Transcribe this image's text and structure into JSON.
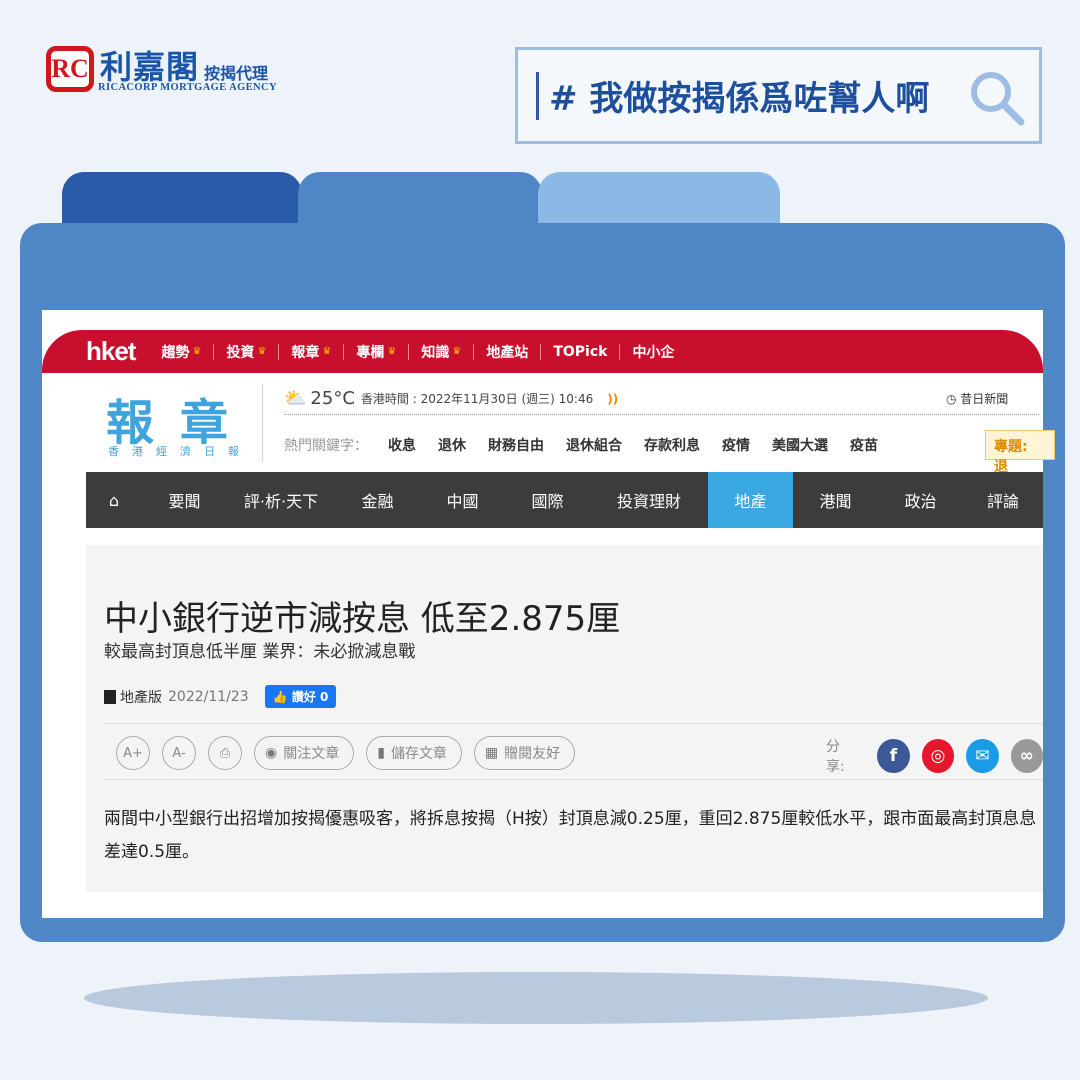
{
  "brand": {
    "logo_mark": "RC",
    "name_cn": "利嘉閣",
    "name_sub": "按揭代理",
    "name_en": "RICACORP MORTGAGE AGENCY"
  },
  "search": {
    "text": "# 我做按揭係爲咗幫人啊",
    "icon": "search-icon"
  },
  "colors": {
    "folder": "#4f86c6",
    "tab_dark": "#2a5ba8",
    "tab_light": "#8ab9e6",
    "hket_red": "#c8102e",
    "nav_active": "#3aa8e0"
  },
  "site": {
    "brand": "hket",
    "top_menu": [
      {
        "label": "趨勢",
        "crown": true
      },
      {
        "label": "投資",
        "crown": true
      },
      {
        "label": "報章",
        "crown": true
      },
      {
        "label": "專欄",
        "crown": true
      },
      {
        "label": "知識",
        "crown": true
      },
      {
        "label": "地產站"
      },
      {
        "label": "TOPick"
      },
      {
        "label": "中小企"
      }
    ],
    "section_logo": "報章",
    "section_logo_sub": "香港經濟日報",
    "weather": {
      "temp": "25°C",
      "time": "香港時間 : 2022年11月30日 (週三) 10:46"
    },
    "yesterday": "昔日新聞",
    "keywords_label": "熱門關鍵字：",
    "keywords": [
      "收息",
      "退休",
      "財務自由",
      "退休組合",
      "存款利息",
      "疫情",
      "美國大選",
      "疫苗"
    ],
    "topic": "專題: 退",
    "nav": [
      "要聞",
      "評·析·天下",
      "金融",
      "中國",
      "國際",
      "投資理財",
      "地產",
      "港聞",
      "政治",
      "評論"
    ],
    "nav_active": "地產"
  },
  "article": {
    "title": "中小銀行逆市減按息 低至2.875厘",
    "subtitle": "較最高封頂息低半厘 業界：未必掀減息戰",
    "section": "地產版",
    "date": "2022/11/23",
    "like": "讚好 0",
    "tools": {
      "font_up": "A+",
      "font_down": "A-",
      "follow": "關注文章",
      "save": "儲存文章",
      "gift": "贈閱友好"
    },
    "share_label": "分享:",
    "body": "兩間中小型銀行出招增加按揭優惠吸客，將拆息按揭（H按）封頂息減0.25厘，重回2.875厘較低水平，跟市面最高封頂息息差達0.5厘。"
  }
}
